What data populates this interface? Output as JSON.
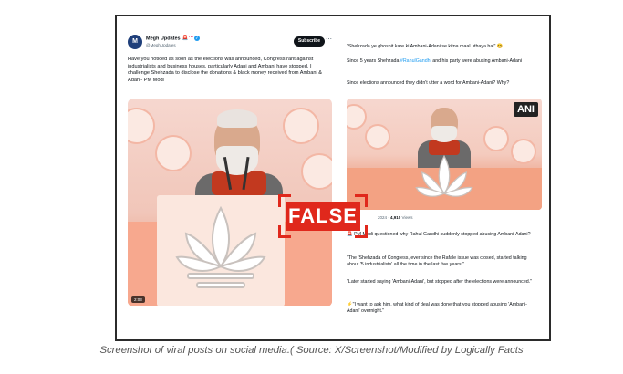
{
  "left_post": {
    "author_name": "Megh Updates",
    "author_flag": "🚨™",
    "handle": "@MeghUpdates",
    "subscribe_label": "Subscribe",
    "text": "Have you noticed as soon as the elections was announced, Congress rant against industrialists and business houses, particularly Adani and Ambani have stopped. I challenge Shehzada to disclose the donations & black money received from Ambani & Adani- PM Modi",
    "video_time": "2:03"
  },
  "right_post": {
    "line1": "\"Shehzada ye ghoshit kare ki Ambani-Adani se kitna maal uthaya hai\" 😆",
    "line2_a": "Since 5 years Shehzada ",
    "line2_link": "#RahulGandhi",
    "line2_b": " and his party were abusing Ambani-Adani",
    "line3": "Since elections announced they didn't utter a word for Ambani-Adani? Why?",
    "media_logo": "ANI",
    "meta_date": "2024 · ",
    "meta_views_count": "4,910",
    "meta_views_label": " Views",
    "p1": "PM Modi questioned why Rahul Gandhi suddenly stopped abusing Ambani-Adani?",
    "p2": "\"The 'Shehzada of Congress, ever since the Rafale issue was closed, started talking about '5 industrialists' all the time in the last five years.\"",
    "p3": "\"Later started saying 'Ambani-Adani', but stopped after the elections were announced.\"",
    "p4": "\"I want to ask him, what kind of deal was done that you stopped abusing 'Ambani-Adani' overnight.\""
  },
  "stamp_label": "FALSE",
  "caption": "Screenshot of viral posts on social media.( Source: X/Screenshot/Modified by Logically Facts",
  "colors": {
    "stamp": "#e0281c",
    "link": "#1d9bf0",
    "saffron": "#e9805f"
  },
  "icons": [
    "verified-badge-icon",
    "more-icon",
    "siren-icon",
    "lightning-icon"
  ]
}
